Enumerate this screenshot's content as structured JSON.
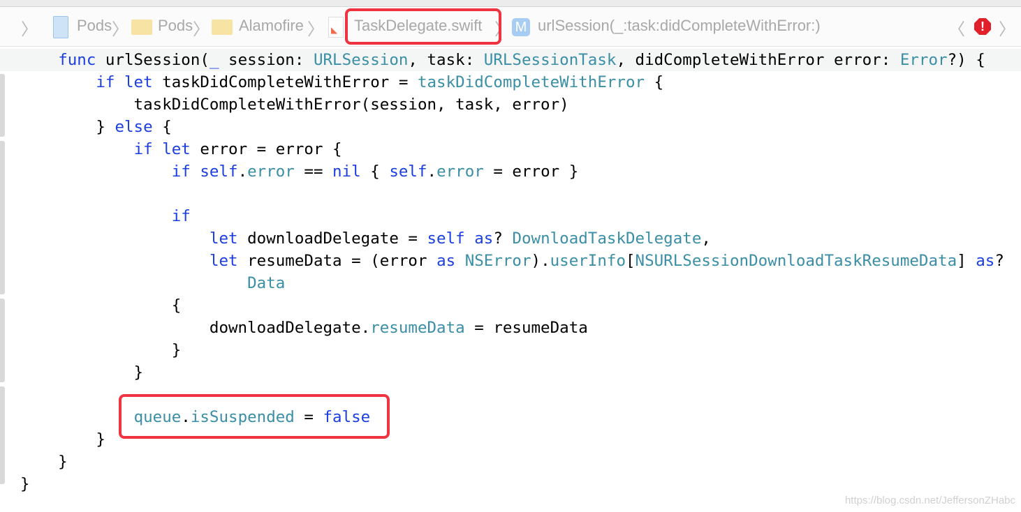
{
  "jumpbar": {
    "items": [
      {
        "label": "Pods",
        "icon": "project-icon"
      },
      {
        "label": "Pods",
        "icon": "folder-icon"
      },
      {
        "label": "Alamofire",
        "icon": "folder-icon"
      },
      {
        "label": "TaskDelegate.swift",
        "icon": "swift-file-icon"
      },
      {
        "label": "urlSession(_:task:didCompleteWithError:)",
        "icon": "method-icon",
        "badge": "M"
      }
    ],
    "error_badge": "!"
  },
  "code": [
    [
      [
        "    "
      ],
      [
        "func",
        "k"
      ],
      [
        " urlSession("
      ],
      [
        "_",
        "k"
      ],
      [
        " session: "
      ],
      [
        "URLSession",
        "t"
      ],
      [
        ", task: "
      ],
      [
        "URLSessionTask",
        "t"
      ],
      [
        ", didCompleteWithError error: "
      ],
      [
        "Error",
        "t"
      ],
      [
        "?) {"
      ]
    ],
    [
      [
        "        "
      ],
      [
        "if",
        "k"
      ],
      [
        " "
      ],
      [
        "let",
        "k"
      ],
      [
        " taskDidCompleteWithError = "
      ],
      [
        "taskDidCompleteWithError",
        "t"
      ],
      [
        " {"
      ]
    ],
    [
      [
        "            taskDidCompleteWithError(session, task, error)"
      ]
    ],
    [
      [
        "        } "
      ],
      [
        "else",
        "k"
      ],
      [
        " {"
      ]
    ],
    [
      [
        "            "
      ],
      [
        "if",
        "k"
      ],
      [
        " "
      ],
      [
        "let",
        "k"
      ],
      [
        " error = error {"
      ]
    ],
    [
      [
        "                "
      ],
      [
        "if",
        "k"
      ],
      [
        " "
      ],
      [
        "self",
        "k"
      ],
      [
        "."
      ],
      [
        "error",
        "t"
      ],
      [
        " == "
      ],
      [
        "nil",
        "k"
      ],
      [
        " { "
      ],
      [
        "self",
        "k"
      ],
      [
        "."
      ],
      [
        "error",
        "t"
      ],
      [
        " = error }"
      ]
    ],
    [
      [
        ""
      ]
    ],
    [
      [
        "                "
      ],
      [
        "if",
        "k"
      ]
    ],
    [
      [
        "                    "
      ],
      [
        "let",
        "k"
      ],
      [
        " downloadDelegate = "
      ],
      [
        "self",
        "k"
      ],
      [
        " "
      ],
      [
        "as",
        "k"
      ],
      [
        "? "
      ],
      [
        "DownloadTaskDelegate",
        "t"
      ],
      [
        ","
      ]
    ],
    [
      [
        "                    "
      ],
      [
        "let",
        "k"
      ],
      [
        " resumeData = (error "
      ],
      [
        "as",
        "k"
      ],
      [
        " "
      ],
      [
        "NSError",
        "t"
      ],
      [
        ")."
      ],
      [
        "userInfo",
        "t"
      ],
      [
        "["
      ],
      [
        "NSURLSessionDownloadTaskResumeData",
        "t"
      ],
      [
        "] "
      ],
      [
        "as",
        "k"
      ],
      [
        "?"
      ]
    ],
    [
      [
        "                        "
      ],
      [
        "Data",
        "t"
      ]
    ],
    [
      [
        "                {"
      ]
    ],
    [
      [
        "                    downloadDelegate."
      ],
      [
        "resumeData",
        "t"
      ],
      [
        " = resumeData"
      ]
    ],
    [
      [
        "                }"
      ]
    ],
    [
      [
        "            }"
      ]
    ],
    [
      [
        ""
      ]
    ],
    [
      [
        "            "
      ],
      [
        "queue",
        "t"
      ],
      [
        "."
      ],
      [
        "isSuspended",
        "t"
      ],
      [
        " = "
      ],
      [
        "false",
        "k"
      ]
    ],
    [
      [
        "        }"
      ]
    ],
    [
      [
        "    }"
      ]
    ],
    [
      [
        "}"
      ]
    ]
  ],
  "watermark": "https://blog.csdn.net/JeffersonZHabc"
}
